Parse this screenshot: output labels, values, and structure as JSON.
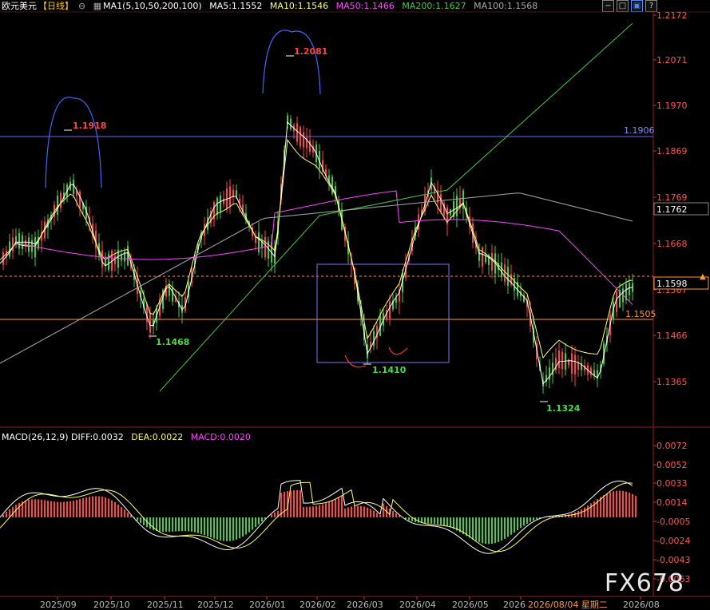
{
  "header": {
    "symbol": "欧元美元",
    "period": "【日线】",
    "ma_label": "MA1(5,10,50,200,100)",
    "ma5": "MA5:1.1552",
    "ma10": "MA10:1.1546",
    "ma50": "MA50:1.1466",
    "ma200": "MA200:1.1627",
    "ma100": "MA100:1.1568"
  },
  "toolbar": {
    "b1": "−",
    "b2": "□",
    "b3": "▣",
    "b4": "?"
  },
  "macd_header": {
    "label": "MACD(26,12,9)",
    "diff": "DIFF:0.0032",
    "dea": "DEA:0.0022",
    "macd": "MACD:0.0020"
  },
  "price_axis": [
    "1.2172",
    "1.2071",
    "1.1970",
    "1.1869",
    "1.1769",
    "1.1668",
    "1.1567",
    "1.1466",
    "1.1365"
  ],
  "macd_axis": [
    "0.0072",
    "0.0052",
    "0.0033",
    "0.0014",
    "-0.0005",
    "-0.0024",
    "-0.0043",
    "-0.0063"
  ],
  "x_axis": [
    "2025/09",
    "2025/10",
    "2025/11",
    "2025/12",
    "2026/01",
    "2026/02",
    "2026/03",
    "2026/04",
    "2026/05",
    "2026/08/04 星期二",
    "2026/08"
  ],
  "x_axis_prefix": "2026",
  "markers": {
    "current_price": "1.1598",
    "hline_blue": "1.1906",
    "ma_tag": "1.1762",
    "support": "1.1505"
  },
  "annotations": {
    "high1": "1.1918",
    "high2": "1.2081",
    "low1": "1.1468",
    "low2": "1.1410",
    "low3": "1.1324"
  },
  "watermark": "FX678",
  "colors": {
    "up": "#ff4444",
    "down": "#44cc44",
    "ma5": "#ffffff",
    "ma10": "#ffff66",
    "ma50": "#ff44ff",
    "ma200": "#44cc44",
    "ma100": "#aaaaaa",
    "hline": "#6666ff",
    "support": "#ff9933"
  }
}
